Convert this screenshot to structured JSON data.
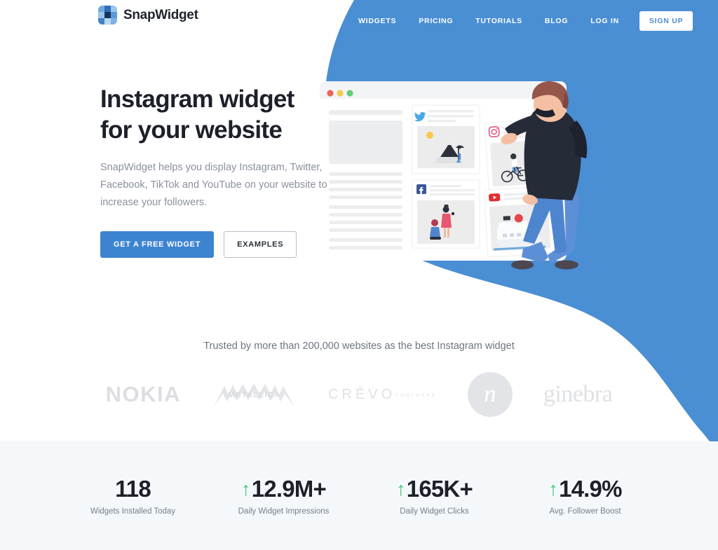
{
  "brand": {
    "name": "SnapWidget",
    "logo_icon": "checkered-squares-logo-icon",
    "accent_blue": "#4a8ed4",
    "primary_button_blue": "#3d84d0",
    "green": "#3ec473",
    "dark_text": "#1d2029"
  },
  "nav": {
    "items": [
      {
        "label": "WIDGETS"
      },
      {
        "label": "PRICING"
      },
      {
        "label": "TUTORIALS"
      },
      {
        "label": "BLOG"
      },
      {
        "label": "LOG IN"
      }
    ],
    "signup_label": "SIGN UP"
  },
  "hero": {
    "headline_line1": "Instagram widget",
    "headline_line2": "for your website",
    "subhead": "SnapWidget helps you display Instagram, Twitter, Facebook, TikTok and YouTube on your website to increase your followers.",
    "primary_cta": "GET A FREE WIDGET",
    "secondary_cta": "EXAMPLES",
    "illustration": {
      "window_dots": [
        "#f0615a",
        "#f5c council",
        "#5cc95c"
      ],
      "cards": [
        {
          "network": "twitter",
          "icon": "twitter-bird-icon"
        },
        {
          "network": "instagram",
          "icon": "instagram-camera-icon"
        },
        {
          "network": "facebook",
          "icon": "facebook-f-icon"
        },
        {
          "network": "youtube",
          "icon": "youtube-play-icon"
        }
      ]
    }
  },
  "social_proof": {
    "headline": "Trusted by more than 200,000 websites as the best Instagram widget",
    "brands": [
      {
        "name": "NOKIA"
      },
      {
        "name": "METALLICA"
      },
      {
        "name": "CRĒVO",
        "sub": "FOOTWEAR"
      },
      {
        "name": "n"
      },
      {
        "name": "ginebra"
      }
    ]
  },
  "stats": [
    {
      "value": "118",
      "label": "Widgets Installed Today",
      "arrow": false
    },
    {
      "value": "12.9M+",
      "label": "Daily Widget Impressions",
      "arrow": true
    },
    {
      "value": "165K+",
      "label": "Daily Widget Clicks",
      "arrow": true
    },
    {
      "value": "14.9%",
      "label": "Avg. Follower Boost",
      "arrow": true
    }
  ]
}
